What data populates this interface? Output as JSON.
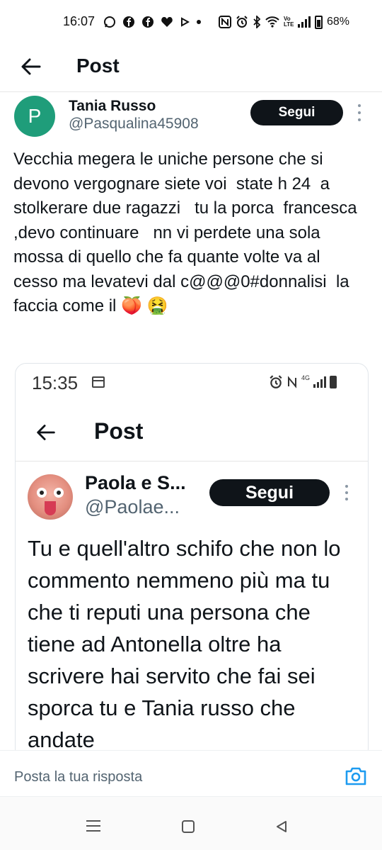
{
  "status_bar": {
    "time": "16:07",
    "battery": "68%",
    "icons": [
      "whatsapp-icon",
      "facebook-icon",
      "facebook-icon",
      "heart-icon",
      "play-icon",
      "dot-icon",
      "nfc-icon",
      "alarm-icon",
      "bluetooth-icon",
      "wifi-icon",
      "volte-icon",
      "signal-icon",
      "battery-icon"
    ],
    "volte": "Vo LTE"
  },
  "header": {
    "title": "Post",
    "back_icon": "back-arrow-icon"
  },
  "post": {
    "author_name": "Tania Russo",
    "author_handle": "@Pasqualina45908",
    "avatar_letter": "P",
    "avatar_color": "#1f9d7a",
    "follow_label": "Segui",
    "text": "Vecchia megera le uniche persone che si devono vergognare siete voi  state h 24  a stolkerare due ragazzi   tu la porca  francesca ,devo continuare   nn vi perdete una sola mossa di quello che fa quante volte va al cesso ma levatevi dal c@@@0#donnalisi  la faccia come il 🍑 🤮"
  },
  "embedded_screenshot": {
    "time": "15:35",
    "net_label": "4G",
    "header_title": "Post",
    "author_name": "Paola e S...",
    "author_handle": "@Paolae...",
    "follow_label": "Segui",
    "text": "Tu e quell'altro schifo che non lo commento nemmeno più ma tu che ti reputi una persona che tiene ad Antonella oltre ha scrivere hai servito che fai sei sporca tu e Tania russo che andate"
  },
  "reply_bar": {
    "placeholder": "Posta la tua risposta",
    "camera_icon": "camera-icon"
  },
  "nav_bar": {
    "items": [
      "recent-apps-icon",
      "home-icon",
      "back-icon"
    ]
  },
  "colors": {
    "follow_bg": "#0f1419",
    "handle_gray": "#536471",
    "accent_blue": "#1d9bf0"
  }
}
